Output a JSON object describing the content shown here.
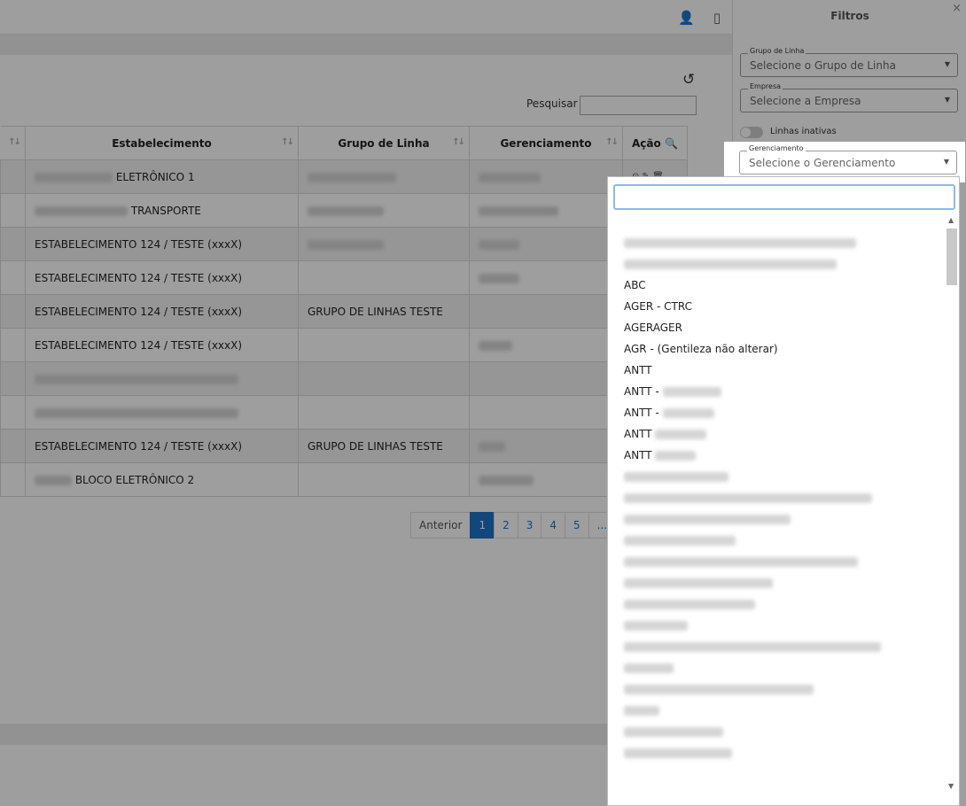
{
  "topbar": {
    "icons": [
      "user-settings-icon",
      "mobile-icon"
    ]
  },
  "search": {
    "label": "Pesquisar",
    "value": ""
  },
  "table": {
    "headers": [
      "Estabelecimento",
      "Grupo de Linha",
      "Gerenciamento",
      "Ação"
    ],
    "rows": [
      {
        "estabelecimento": "ELETRÔNICO 1",
        "grupo": "",
        "gerenciamento": ""
      },
      {
        "estabelecimento": "TRANSPORTE",
        "grupo": "",
        "gerenciamento": ""
      },
      {
        "estabelecimento": "ESTABELECIMENTO 124 / TESTE (xxxX)",
        "grupo": "",
        "gerenciamento": ""
      },
      {
        "estabelecimento": "ESTABELECIMENTO 124 / TESTE (xxxX)",
        "grupo": "",
        "gerenciamento": ""
      },
      {
        "estabelecimento": "ESTABELECIMENTO 124 / TESTE (xxxX)",
        "grupo": "GRUPO DE LINHAS TESTE",
        "gerenciamento": ""
      },
      {
        "estabelecimento": "ESTABELECIMENTO 124 / TESTE (xxxX)",
        "grupo": "",
        "gerenciamento": ""
      },
      {
        "estabelecimento": "",
        "grupo": "",
        "gerenciamento": ""
      },
      {
        "estabelecimento": "",
        "grupo": "",
        "gerenciamento": ""
      },
      {
        "estabelecimento": "ESTABELECIMENTO 124 / TESTE (xxxX)",
        "grupo": "GRUPO DE LINHAS TESTE",
        "gerenciamento": ""
      },
      {
        "estabelecimento": "BLOCO ELETRÔNICO 2",
        "grupo": "",
        "gerenciamento": ""
      }
    ]
  },
  "pagination": {
    "prev": "Anterior",
    "pages": [
      "1",
      "2",
      "3",
      "4",
      "5",
      "..."
    ],
    "current": "1"
  },
  "filters": {
    "title": "Filtros",
    "close": "×",
    "grupo_linha": {
      "legend": "Grupo de Linha",
      "placeholder": "Selecione o Grupo de Linha"
    },
    "empresa": {
      "legend": "Empresa",
      "placeholder": "Selecione a Empresa"
    },
    "inactive_label": "Linhas inativas",
    "gerenciamento": {
      "legend": "Gerenciamento",
      "placeholder": "Selecione o Gerenciamento"
    }
  },
  "dropdown": {
    "search_value": "",
    "options": [
      "",
      "",
      "ABC",
      "AGER - CTRC",
      "AGERAGER",
      "AGR - (Gentileza não alterar)",
      "ANTT",
      "ANTT -",
      "ANTT -",
      "ANTT",
      "ANTT",
      "",
      "",
      "",
      "",
      "",
      "",
      "",
      "",
      "",
      "",
      "",
      "",
      "",
      ""
    ]
  }
}
